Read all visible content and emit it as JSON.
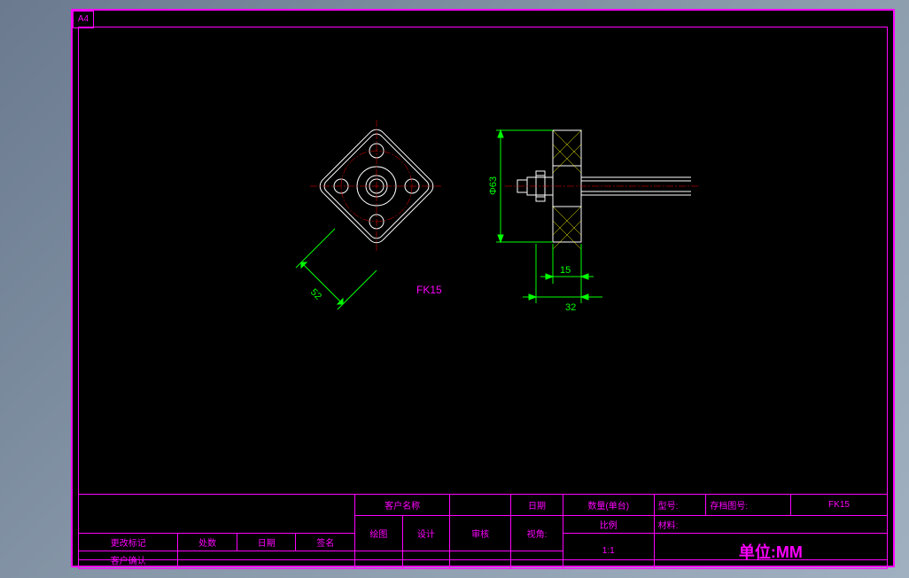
{
  "frame": {
    "size_label": "A4"
  },
  "drawing": {
    "part_name": "FK15",
    "dimensions": {
      "diag_52": "52",
      "dia_63": "Φ63",
      "width_15": "15",
      "width_32": "32"
    }
  },
  "titleblock": {
    "row1": {
      "customer_name_label": "客户名称",
      "customer_name_value": "",
      "date_label": "日期",
      "qty_label": "数量(单台)",
      "model_label": "型号:",
      "archive_label": "存档图号:",
      "archive_value": "FK15"
    },
    "row2": {
      "change_mark": "更改标记",
      "place": "处数",
      "date": "日期",
      "sign": "签名",
      "drawn": "绘图",
      "design": "设计",
      "review": "审核",
      "angle": "视角:",
      "scale_label": "比例",
      "material_label": "材料:"
    },
    "row3": {
      "customer_confirm": "客户确认",
      "scale_value": "1:1",
      "unit": "单位:MM"
    }
  }
}
